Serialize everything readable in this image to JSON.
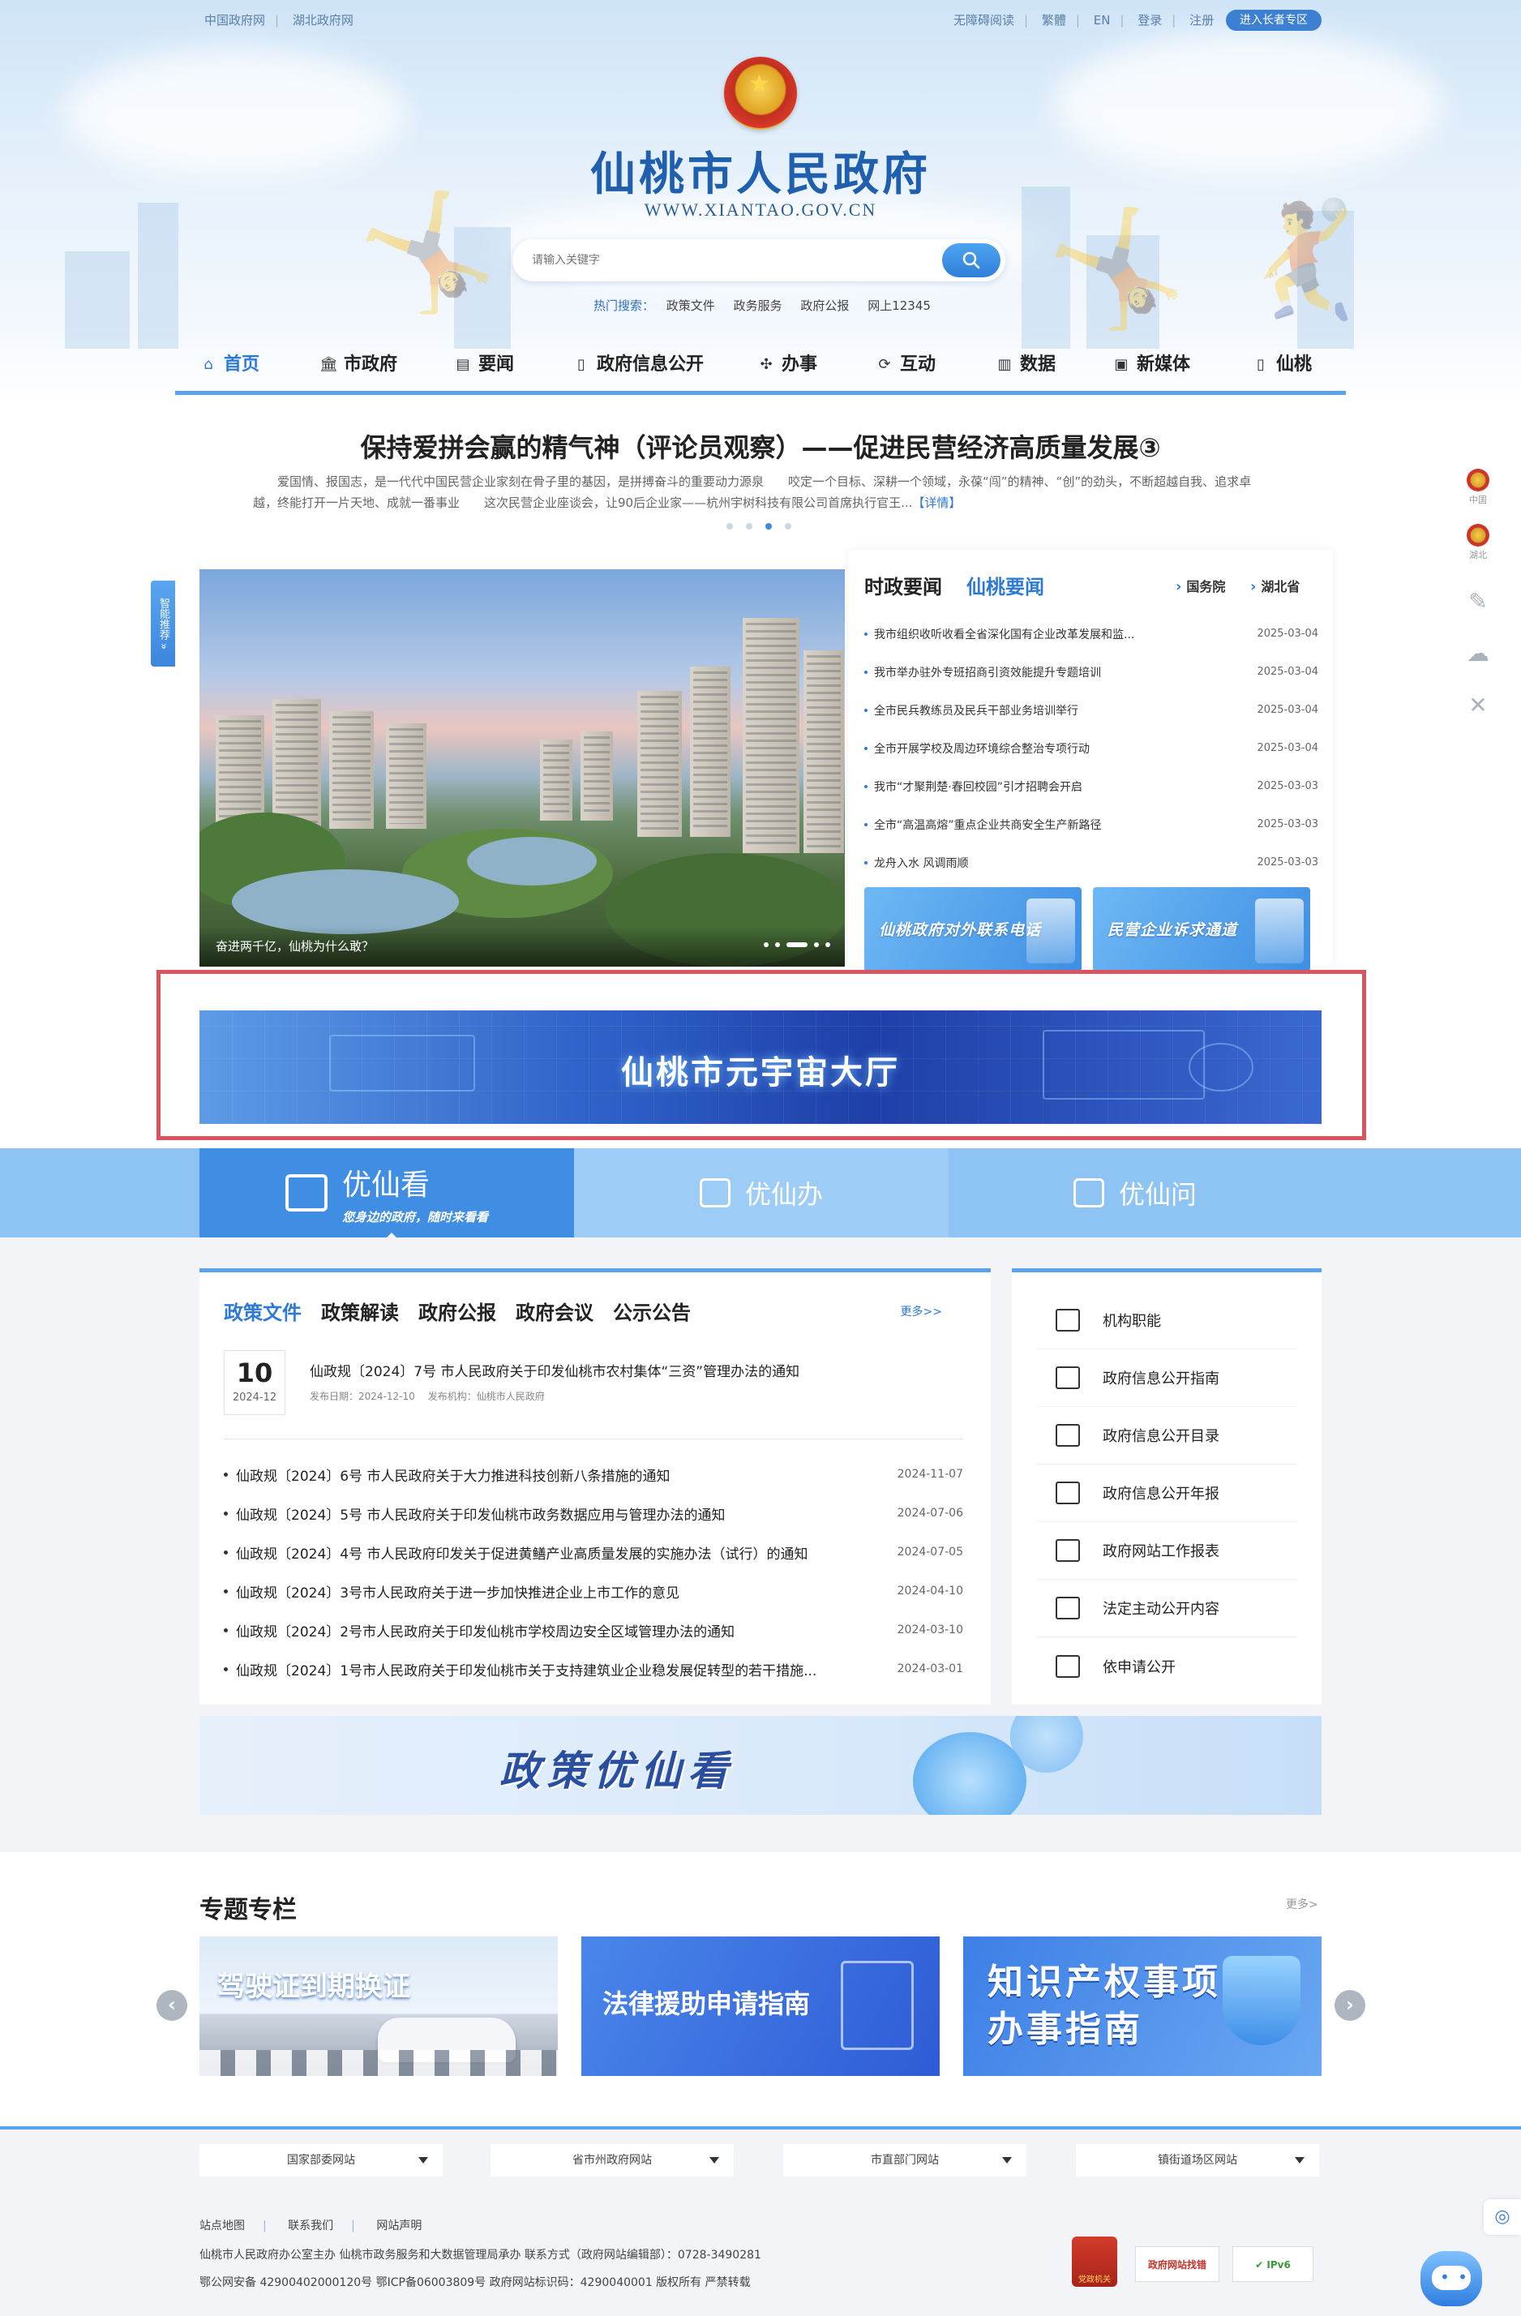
{
  "top_links": {
    "left": [
      "中国政府网",
      "湖北政府网"
    ],
    "right": [
      "无障碍阅读",
      "繁體",
      "EN",
      "登录",
      "注册"
    ],
    "elder_button": "进入长者专区"
  },
  "header": {
    "site_title": "仙桃市人民政府",
    "site_url": "WWW.XIANTAO.GOV.CN"
  },
  "search": {
    "placeholder": "请输入关键字",
    "hot_label": "热门搜索：",
    "hot_terms": [
      "政策文件",
      "政务服务",
      "政府公报",
      "网上12345"
    ]
  },
  "nav": {
    "items": [
      {
        "label": "首页",
        "icon": "home-icon",
        "active": true
      },
      {
        "label": "市政府",
        "icon": "government-icon"
      },
      {
        "label": "要闻",
        "icon": "newspaper-icon"
      },
      {
        "label": "政府信息公开",
        "icon": "book-icon"
      },
      {
        "label": "办事",
        "icon": "grid-icon"
      },
      {
        "label": "互动",
        "icon": "chat-icon"
      },
      {
        "label": "数据",
        "icon": "bar-chart-icon"
      },
      {
        "label": "新媒体",
        "icon": "media-icon"
      },
      {
        "label": "仙桃",
        "icon": "city-icon"
      }
    ]
  },
  "headline": {
    "title": "保持爱拼会赢的精气神（评论员观察）——促进民营经济高质量发展③",
    "desc": "爱国情、报国志，是一代代中国民营企业家刻在骨子里的基因，是拼搏奋斗的重要动力源泉　　咬定一个目标、深耕一个领域，永葆“闯”的精神、“创”的劲头，不断超越自我、追求卓越，终能打开一片天地、成就一番事业　　这次民营企业座谈会，让90后企业家——杭州宇树科技有限公司首席执行官王...",
    "more": "【详情】"
  },
  "side_tabs": {
    "smart_tab": "智能推荐",
    "rail": [
      {
        "label": "中国",
        "icon": "emblem-icon"
      },
      {
        "label": "湖北",
        "icon": "emblem-icon"
      },
      {
        "label": "",
        "icon": "edit-icon"
      },
      {
        "label": "",
        "icon": "wechat-icon"
      },
      {
        "label": "",
        "icon": "close-icon"
      }
    ]
  },
  "carousel": {
    "caption": "奋进两千亿，仙桃为什么敢？"
  },
  "news": {
    "tab1": "时政要闻",
    "tab2": "仙桃要闻",
    "link1": "国务院",
    "link2": "湖北省",
    "items": [
      {
        "title": "我市组织收听收看全省深化国有企业改革发展和监...",
        "date": "2025-03-04"
      },
      {
        "title": "我市举办驻外专班招商引资效能提升专题培训",
        "date": "2025-03-04"
      },
      {
        "title": "全市民兵教练员及民兵干部业务培训举行",
        "date": "2025-03-04"
      },
      {
        "title": "全市开展学校及周边环境综合整治专项行动",
        "date": "2025-03-04"
      },
      {
        "title": "我市“才聚荆楚·春回校园”引才招聘会开启",
        "date": "2025-03-03"
      },
      {
        "title": "全市“高温高熔”重点企业共商安全生产新路径",
        "date": "2025-03-03"
      },
      {
        "title": "龙舟入水 风调雨顺",
        "date": "2025-03-03"
      }
    ],
    "banner1": "仙桃政府对外联系电话",
    "banner2": "民营企业诉求通道"
  },
  "metaverse": {
    "title": "仙桃市元宇宙大厅"
  },
  "band": {
    "tab1": "优仙看",
    "tab1_sub": "您身边的政府，随时来看看",
    "tab2": "优仙办",
    "tab3": "优仙问"
  },
  "policy": {
    "tabs": [
      "政策文件",
      "政策解读",
      "政府公报",
      "政府会议",
      "公示公告"
    ],
    "more": "更多>>",
    "featured": {
      "day": "10",
      "year_month": "2024-12",
      "title": "仙政规〔2024〕7号 市人民政府关于印发仙桃市农村集体“三资”管理办法的通知",
      "date_meta": "发布日期：2024-12-10",
      "org_meta": "发布机构：仙桃市人民政府"
    },
    "items": [
      {
        "title": "仙政规〔2024〕6号 市人民政府关于大力推进科技创新八条措施的通知",
        "date": "2024-11-07"
      },
      {
        "title": "仙政规〔2024〕5号 市人民政府关于印发仙桃市政务数据应用与管理办法的通知",
        "date": "2024-07-06"
      },
      {
        "title": "仙政规〔2024〕4号 市人民政府印发关于促进黄鳝产业高质量发展的实施办法（试行）的通知",
        "date": "2024-07-05"
      },
      {
        "title": "仙政规〔2024〕3号市人民政府关于进一步加快推进企业上市工作的意见",
        "date": "2024-04-10"
      },
      {
        "title": "仙政规〔2024〕2号市人民政府关于印发仙桃市学校周边安全区域管理办法的通知",
        "date": "2024-03-10"
      },
      {
        "title": "仙政规〔2024〕1号市人民政府关于印发仙桃市关于支持建筑业企业稳发展促转型的若干措施...",
        "date": "2024-03-01"
      }
    ]
  },
  "info_links": [
    {
      "label": "机构职能",
      "icon": "document-icon"
    },
    {
      "label": "政府信息公开指南",
      "icon": "signpost-icon"
    },
    {
      "label": "政府信息公开目录",
      "icon": "catalog-icon"
    },
    {
      "label": "政府信息公开年报",
      "icon": "calendar-icon"
    },
    {
      "label": "政府网站工作报表",
      "icon": "monitor-icon"
    },
    {
      "label": "法定主动公开内容",
      "icon": "open-book-icon"
    },
    {
      "label": "依申请公开",
      "icon": "form-icon"
    }
  ],
  "policy_banner": {
    "title": "政策优仙看"
  },
  "special": {
    "title": "专题专栏",
    "more": "更多>",
    "cards": [
      "驾驶证到期换证",
      "法律援助申请指南",
      "知识产权事项办事指南"
    ]
  },
  "footer": {
    "selects": [
      "国家部委网站",
      "省市州政府网站",
      "市直部门网站",
      "镇街道场区网站"
    ],
    "links": [
      "站点地图",
      "联系我们",
      "网站声明"
    ],
    "line1": "仙桃市人民政府办公室主办 仙桃市政务服务和大数据管理局承办 联系方式（政府网站编辑部）：0728-3490281",
    "line2": "鄂公网安备 42900402000120号 鄂ICP备06003809号 政府网站标识码：4290040001 版权所有 严禁转载",
    "badges": [
      "党政机关",
      "政府网站找错",
      "IPv6"
    ]
  },
  "colors": {
    "primary": "#2d7ad6",
    "nav_line": "#5aa2ec",
    "highlight_frame": "#d9545e",
    "band_active": "#3f8ee3"
  }
}
